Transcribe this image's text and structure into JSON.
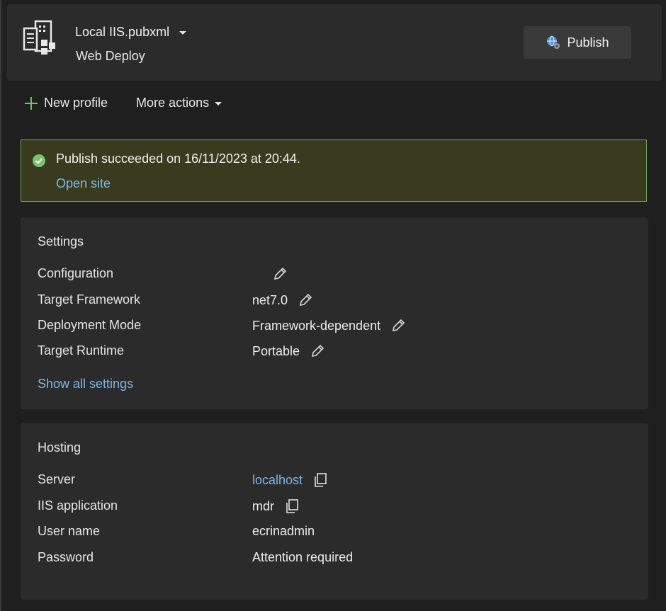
{
  "header": {
    "profile_name": "Local IIS.pubxml",
    "profile_subtitle": "Web Deploy",
    "publish_label": "Publish"
  },
  "toolbar": {
    "new_profile": "New profile",
    "more_actions": "More actions"
  },
  "status": {
    "message": "Publish succeeded on 16/11/2023 at 20:44.",
    "open_site": "Open site"
  },
  "settings": {
    "title": "Settings",
    "rows": [
      {
        "label": "Configuration",
        "value": ""
      },
      {
        "label": "Target Framework",
        "value": "net7.0"
      },
      {
        "label": "Deployment Mode",
        "value": "Framework-dependent"
      },
      {
        "label": "Target Runtime",
        "value": "Portable"
      }
    ],
    "show_all": "Show all settings"
  },
  "hosting": {
    "title": "Hosting",
    "rows": [
      {
        "label": "Server",
        "value": "localhost"
      },
      {
        "label": "IIS application",
        "value": "mdr"
      },
      {
        "label": "User name",
        "value": "ecrinadmin"
      },
      {
        "label": "Password",
        "value": "Attention required"
      }
    ]
  },
  "colors": {
    "background": "#1f1f1f",
    "card": "#2b2b2b",
    "success_bg": "#393b1e",
    "success_border": "#6aa84f",
    "link": "#7fb6e8",
    "plus_green": "#6fc36a"
  },
  "icons": {
    "profile": "server-document-icon",
    "publish": "globe-gear-icon",
    "success": "check-circle-icon",
    "edit": "pencil-icon",
    "copy": "copy-icon",
    "add": "plus-icon",
    "dropdown": "caret-down-icon"
  }
}
